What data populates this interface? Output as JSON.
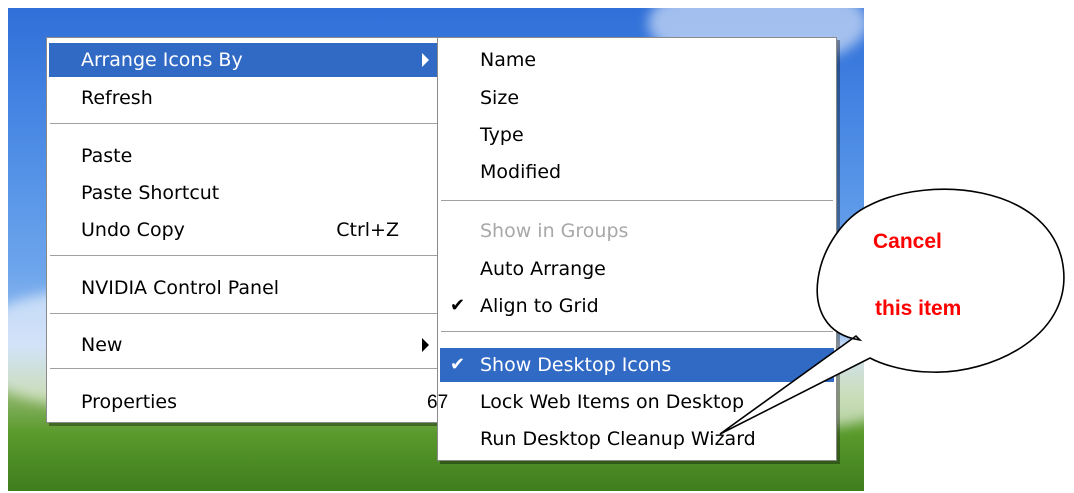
{
  "menus": {
    "main": {
      "arrange_icons_by": "Arrange Icons By",
      "refresh": "Refresh",
      "paste": "Paste",
      "paste_shortcut": "Paste Shortcut",
      "undo_copy": "Undo Copy",
      "undo_copy_shortcut": "Ctrl+Z",
      "nvidia": "NVIDIA Control Panel",
      "new": "New",
      "properties": "Properties"
    },
    "arrange_submenu": {
      "name": "Name",
      "size": "Size",
      "type": "Type",
      "modified": "Modified",
      "show_in_groups": "Show in Groups",
      "auto_arrange": "Auto Arrange",
      "align_to_grid": "Align to Grid",
      "show_desktop_icons": "Show Desktop Icons",
      "lock_web_items": "Lock Web Items on Desktop",
      "run_cleanup": "Run Desktop Cleanup Wizard"
    }
  },
  "check_glyph": "✔",
  "page_number": "67",
  "callout": {
    "line1": "Cancel",
    "line2": "this item",
    "color": "#ff0000"
  },
  "colors": {
    "highlight": "#316ac5",
    "disabled_text": "#a8a8a8"
  }
}
